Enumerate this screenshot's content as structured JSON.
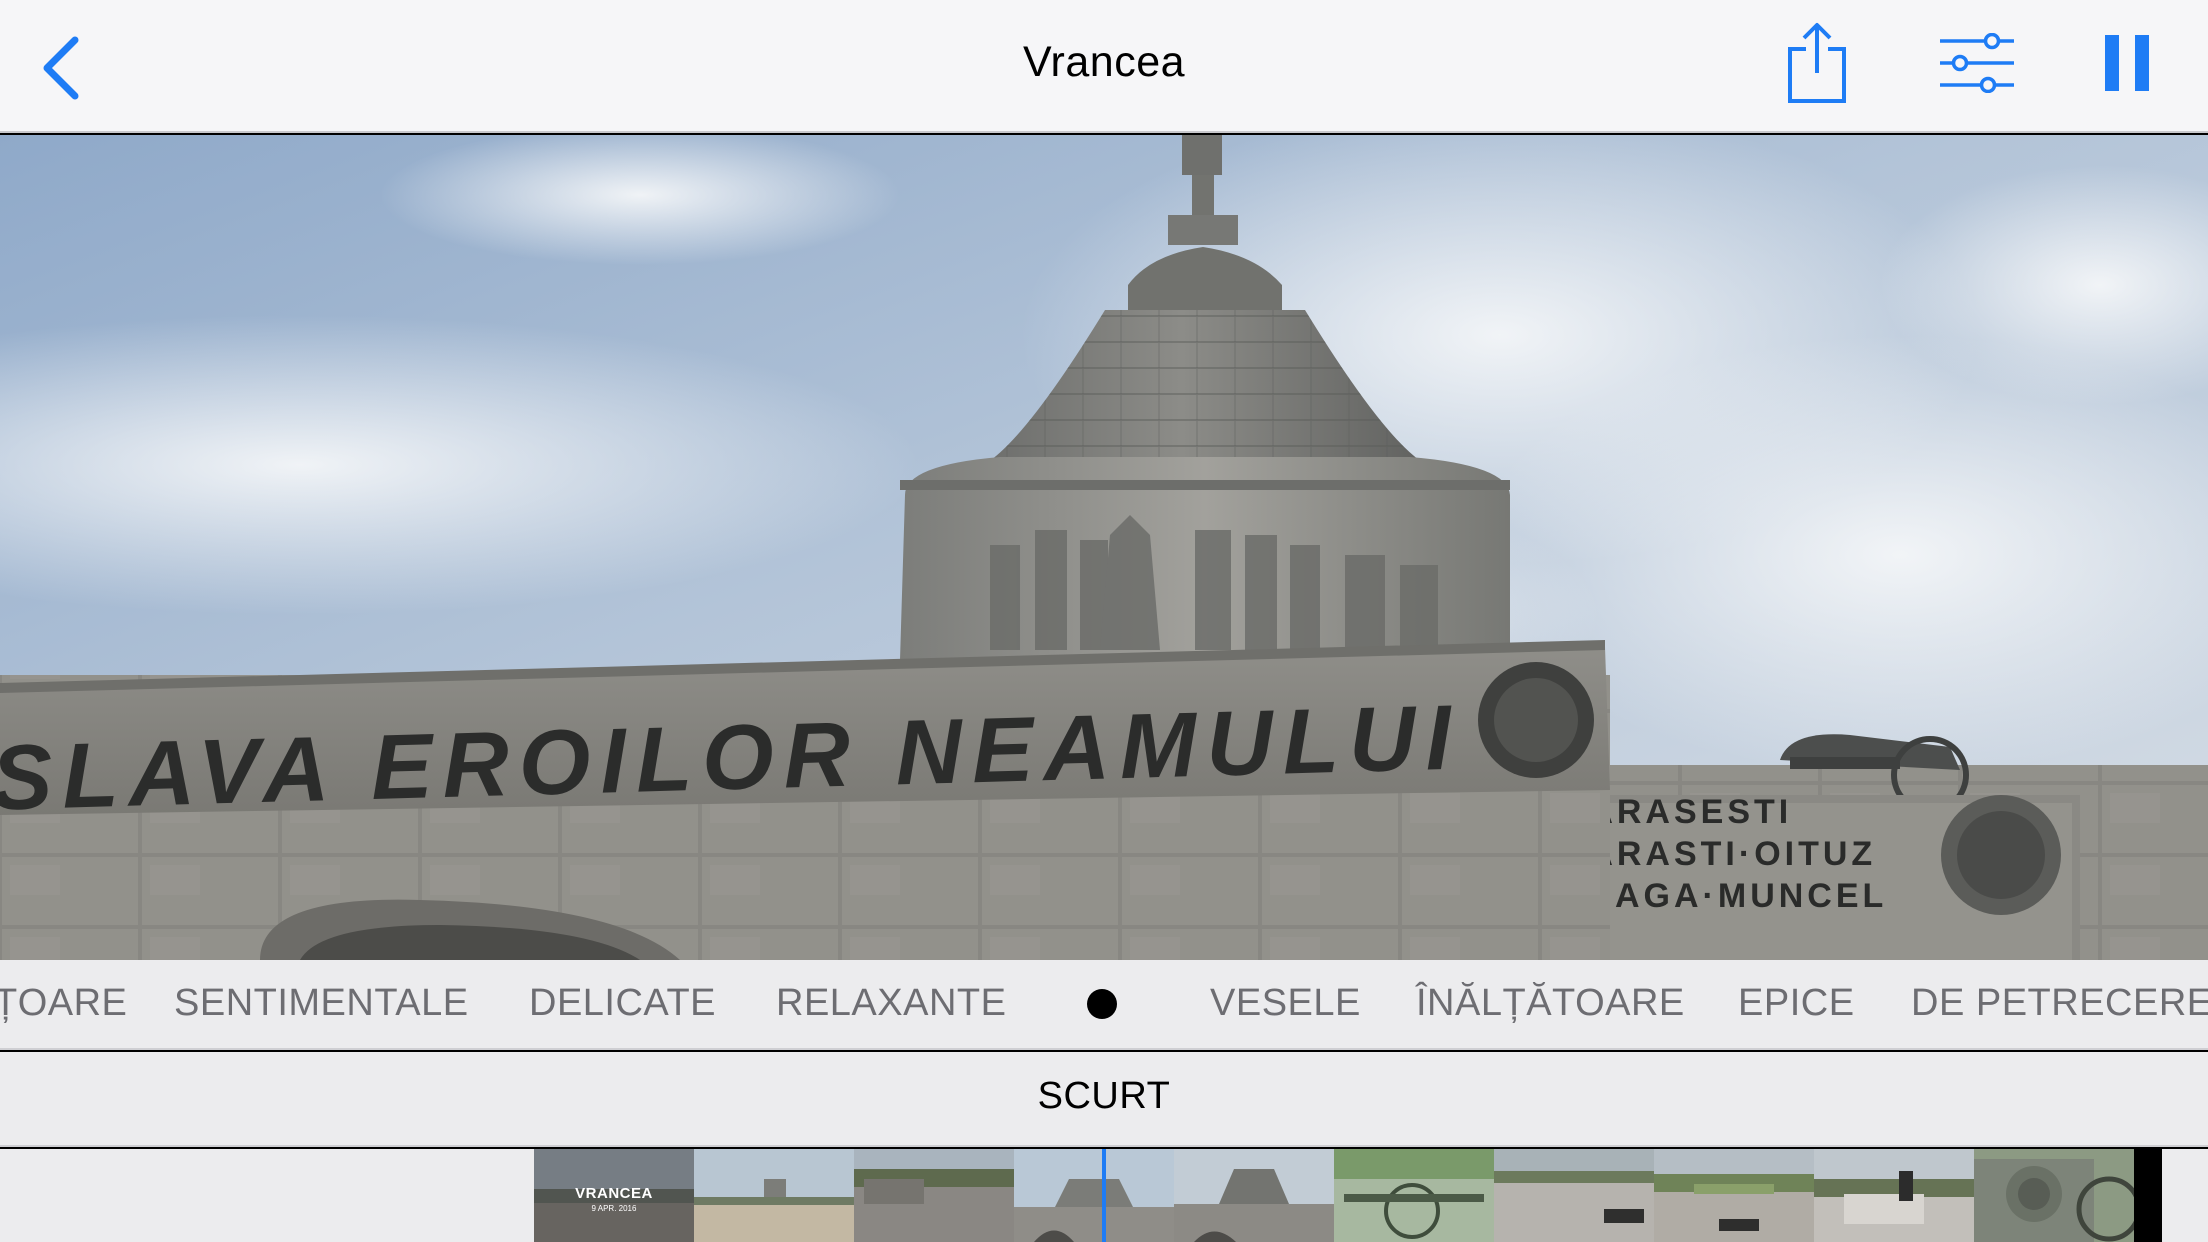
{
  "nav": {
    "title": "Vrancea",
    "back_label": "Back",
    "accent_color": "#1e7cf5"
  },
  "preview": {
    "inscription_main": "SLAVA EROILOR NEAMULUI",
    "inscription_right": [
      "MARASESTI",
      "MARASTI·OITUZ",
      "DOAGA·MUNCEL"
    ]
  },
  "moods": {
    "items": [
      "ȚOARE",
      "SENTIMENTALE",
      "DELICATE",
      "RELAXANTE",
      "VESELE",
      "ÎNĂLȚĂTOARE",
      "EPICE",
      "DE PETRECERE"
    ],
    "selected_indicator": "dot"
  },
  "duration": {
    "selected": "SCURT"
  },
  "filmstrip": {
    "title_thumb": {
      "title": "VRANCEA",
      "date": "9 APR. 2016"
    }
  }
}
